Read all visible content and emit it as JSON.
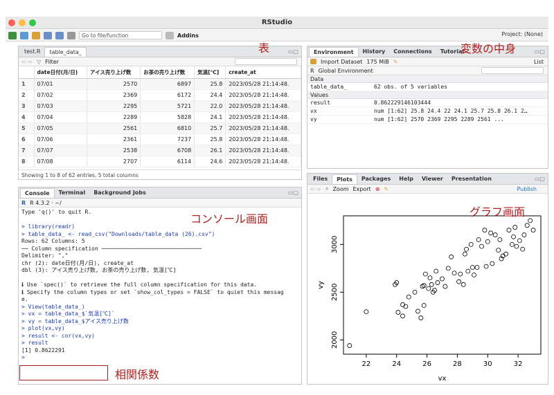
{
  "window_title": "RStudio",
  "toolbar": {
    "goto_placeholder": "Go to file/function",
    "addins": "Addins",
    "project": "Project: (None)"
  },
  "source_pane": {
    "tabs": [
      "test.R",
      "table_data_"
    ],
    "filter_label": "Filter",
    "columns": [
      "",
      "date日付(月/日)",
      "アイス売り上げ数",
      "お茶の売り上げ数",
      "気温[℃]",
      "create_at"
    ],
    "rows": [
      [
        "1",
        "07/01",
        "2570",
        "6897",
        "25.8",
        "2023/05/28 21:14:48."
      ],
      [
        "2",
        "07/02",
        "2369",
        "6172",
        "24.4",
        "2023/05/28 21:14:48."
      ],
      [
        "3",
        "07/03",
        "2295",
        "5721",
        "22.0",
        "2023/05/28 21:14:48."
      ],
      [
        "4",
        "07/04",
        "2289",
        "5828",
        "24.1",
        "2023/05/28 21:14:48."
      ],
      [
        "5",
        "07/05",
        "2561",
        "6810",
        "25.7",
        "2023/05/28 21:14:48."
      ],
      [
        "6",
        "07/06",
        "2361",
        "7237",
        "25.8",
        "2023/05/28 21:14:48."
      ],
      [
        "7",
        "07/07",
        "2538",
        "6708",
        "26.1",
        "2023/05/28 21:14:48."
      ],
      [
        "8",
        "07/08",
        "2707",
        "6114",
        "24.6",
        "2023/05/28 21:14:48."
      ]
    ],
    "footer": "Showing 1 to 8 of 62 entries, 5 total columns"
  },
  "env_pane": {
    "tabs": [
      "Environment",
      "History",
      "Connections",
      "Tutorial"
    ],
    "import_label": "Import Dataset",
    "memory": "175 MiB",
    "list_label": "List",
    "r_label": "R",
    "global_env": "Global Environment",
    "data_header": "Data",
    "values_header": "Values",
    "data": [
      {
        "name": "table_data_",
        "value": "62 obs. of 5 variables"
      }
    ],
    "values": [
      {
        "name": "result",
        "value": "0.862229146103444"
      },
      {
        "name": "vx",
        "value": "num [1:62] 25.8 24.4 22 24.1 25.7 25.8 26.1 2…"
      },
      {
        "name": "vy",
        "value": "num [1:62] 2570 2369 2295 2289 2561 ..."
      }
    ]
  },
  "console_pane": {
    "tabs": [
      "Console",
      "Terminal",
      "Background Jobs"
    ],
    "r_version": "R 4.3.2 · ~/",
    "lines": [
      {
        "t": "Type 'q()' to quit R.",
        "c": ""
      },
      {
        "t": "",
        "c": ""
      },
      {
        "t": "> library(readr)",
        "c": "c-blue"
      },
      {
        "t": "> table_data_ <- read_csv(\"Downloads/table_data (26).csv\")",
        "c": "c-blue"
      },
      {
        "t": "Rows: 62 Columns: 5",
        "c": ""
      },
      {
        "t": "── Column specification ──────────────────────────────",
        "c": ""
      },
      {
        "t": "Delimiter: \",\"",
        "c": ""
      },
      {
        "t": "chr (2): date日付(月/日), create_at",
        "c": ""
      },
      {
        "t": "dbl (3): アイス売り上げ数, お茶の売り上げ数, 気温[℃]",
        "c": ""
      },
      {
        "t": "",
        "c": ""
      },
      {
        "t": "ℹ Use `spec()` to retrieve the full column specification for this data.",
        "c": ""
      },
      {
        "t": "ℹ Specify the column types or set `show_col_types = FALSE` to quiet this messag",
        "c": ""
      },
      {
        "t": "e.",
        "c": ""
      },
      {
        "t": "> View(table_data_)",
        "c": "c-blue"
      },
      {
        "t": "> vx = table_data_$`気温[℃]`",
        "c": "c-blue"
      },
      {
        "t": "> vy = table_data_$アイス売り上げ数",
        "c": "c-blue"
      },
      {
        "t": "> plot(vx,vy)",
        "c": "c-blue"
      },
      {
        "t": "> result <- cor(vx,vy)",
        "c": "c-blue"
      },
      {
        "t": "> result",
        "c": "c-blue"
      },
      {
        "t": "[1] 0.8622291",
        "c": ""
      },
      {
        "t": ">",
        "c": "c-blue"
      }
    ]
  },
  "plots_pane": {
    "tabs": [
      "Files",
      "Plots",
      "Packages",
      "Help",
      "Viewer",
      "Presentation"
    ],
    "zoom": "Zoom",
    "export": "Export",
    "publish": "Publish"
  },
  "annotations": {
    "table": "表",
    "vars": "変数の中身",
    "console": "コンソール画面",
    "graph": "グラフ画面",
    "corr": "相関係数"
  },
  "chart_data": {
    "type": "scatter",
    "xlabel": "vx",
    "ylabel": "vy",
    "xlim": [
      20.5,
      33.5
    ],
    "ylim": [
      1850,
      3300
    ],
    "xticks": [
      22,
      24,
      26,
      28,
      30,
      32
    ],
    "yticks": [
      2000,
      2500,
      3000
    ],
    "points": [
      [
        20.9,
        1940
      ],
      [
        22.0,
        2295
      ],
      [
        23.9,
        2580
      ],
      [
        24.0,
        2600
      ],
      [
        24.1,
        2289
      ],
      [
        24.4,
        2369
      ],
      [
        24.4,
        2250
      ],
      [
        24.6,
        2350
      ],
      [
        24.8,
        2450
      ],
      [
        25.2,
        2500
      ],
      [
        25.4,
        2300
      ],
      [
        25.6,
        2230
      ],
      [
        25.7,
        2561
      ],
      [
        25.8,
        2570
      ],
      [
        25.8,
        2361
      ],
      [
        25.9,
        2690
      ],
      [
        26.1,
        2538
      ],
      [
        26.2,
        2650
      ],
      [
        26.3,
        2580
      ],
      [
        26.4,
        2500
      ],
      [
        26.5,
        2520
      ],
      [
        26.6,
        2720
      ],
      [
        26.7,
        2600
      ],
      [
        27.0,
        2640
      ],
      [
        27.2,
        2560
      ],
      [
        27.4,
        2750
      ],
      [
        27.6,
        2870
      ],
      [
        27.8,
        2700
      ],
      [
        28.1,
        2610
      ],
      [
        28.2,
        2690
      ],
      [
        28.4,
        2580
      ],
      [
        28.5,
        2900
      ],
      [
        28.6,
        2950
      ],
      [
        28.7,
        2720
      ],
      [
        28.9,
        3000
      ],
      [
        29.0,
        2760
      ],
      [
        29.1,
        2680
      ],
      [
        29.3,
        2760
      ],
      [
        29.4,
        3050
      ],
      [
        29.6,
        2980
      ],
      [
        29.8,
        3150
      ],
      [
        29.9,
        2770
      ],
      [
        30.0,
        3030
      ],
      [
        30.2,
        3120
      ],
      [
        30.3,
        2800
      ],
      [
        30.5,
        3100
      ],
      [
        30.7,
        2940
      ],
      [
        30.8,
        3050
      ],
      [
        30.9,
        2850
      ],
      [
        31.0,
        2880
      ],
      [
        31.2,
        2900
      ],
      [
        31.4,
        3150
      ],
      [
        31.6,
        3000
      ],
      [
        31.8,
        3180
      ],
      [
        31.9,
        2980
      ],
      [
        32.1,
        3040
      ],
      [
        32.3,
        2950
      ],
      [
        32.4,
        3100
      ],
      [
        32.6,
        3200
      ],
      [
        32.8,
        3250
      ],
      [
        33.0,
        3150
      ],
      [
        31.7,
        3080
      ]
    ]
  }
}
